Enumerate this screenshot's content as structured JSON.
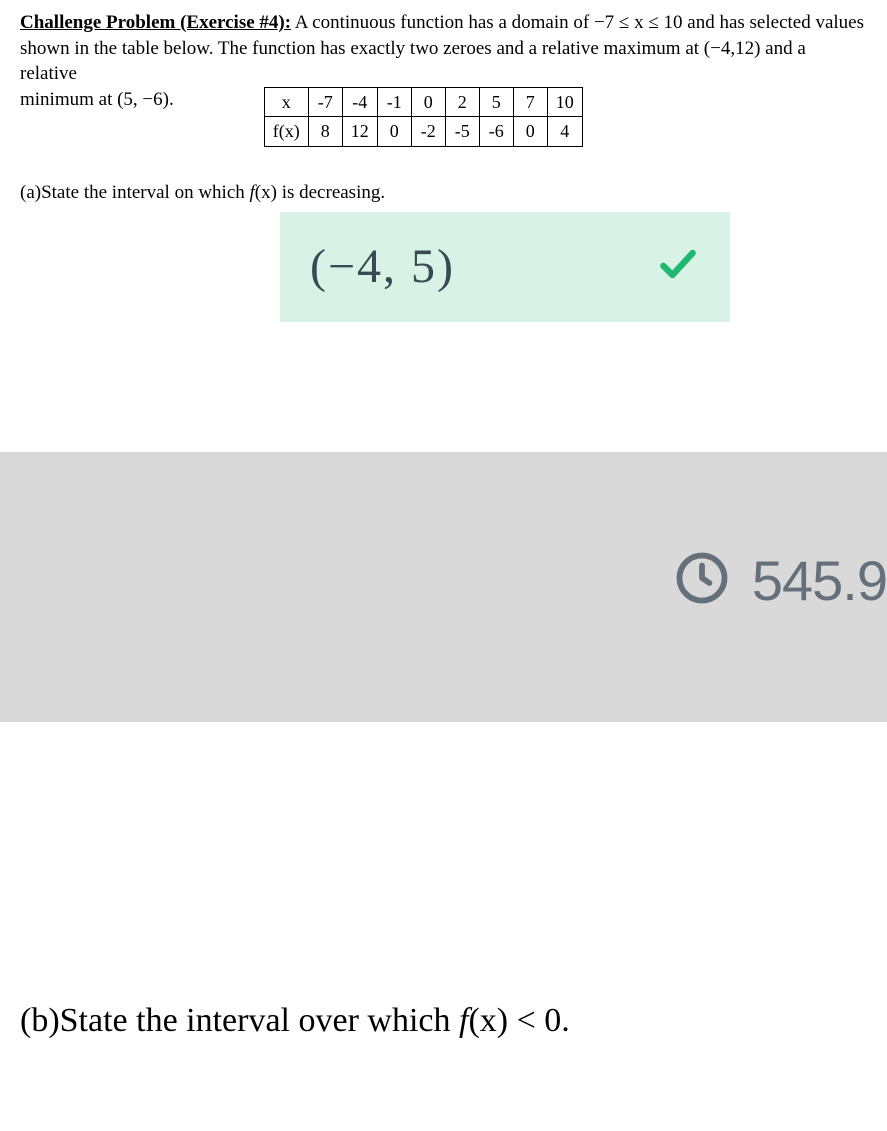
{
  "problem": {
    "title": "Challenge Problem (Exercise #4):",
    "text_line1": " A continuous function has a domain of −7 ≤ x ≤ 10 and has selected values",
    "text_line2": "shown in the table below. The function has exactly two zeroes and a relative maximum at (−4,12) and a relative",
    "text_line3_prefix": "minimum at (5, −6).",
    "table_row1_label": "x",
    "table_row1": [
      "-7",
      "-4",
      "-1",
      "0",
      "2",
      "5",
      "7",
      "10"
    ],
    "table_row2_label": "f(x)",
    "table_row2": [
      "8",
      "12",
      "0",
      "-2",
      "-5",
      "-6",
      "0",
      "4"
    ]
  },
  "part_a": {
    "prompt_prefix": "(a)State the interval on which ",
    "prompt_fx": "f",
    "prompt_after_f": "(x) is decreasing.",
    "answer": "(−4, 5)"
  },
  "timer": {
    "value": "545.9"
  },
  "part_b": {
    "prompt_prefix": "(b)State the interval over which ",
    "prompt_fx": "f",
    "prompt_after_f": "(x) < 0."
  }
}
